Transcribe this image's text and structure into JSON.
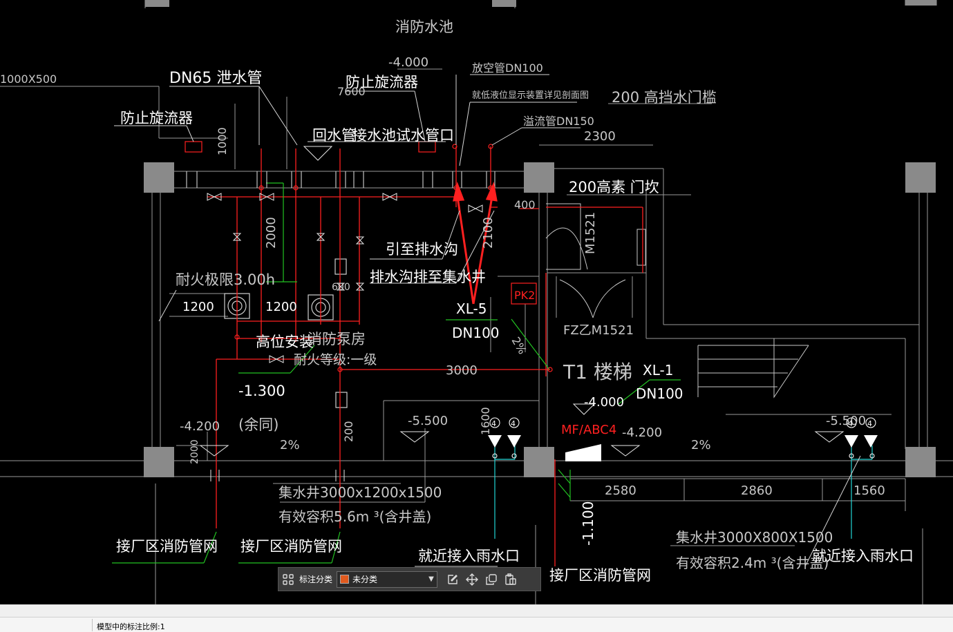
{
  "drawing": {
    "labels": {
      "pool": "消防水池",
      "elev_top": "-4.000",
      "vent": "放空管DN100",
      "gauge": "就低液位显示装置详见剖面图",
      "dn65": "DN65 泄水管",
      "vortex1": "防止旋流器",
      "vortex2": "防止旋流器",
      "dim_7600": "7600",
      "size_left": "1000X500",
      "door_sill": "200  高挡水门槛",
      "overflow": "溢流管DN150",
      "return": "回水管",
      "test": "接水池试水管口",
      "dim_1000": "1000",
      "dim_2300": "2300",
      "door_200": "200高素 门坎",
      "dim_400": "400",
      "m1521": "M1521",
      "to_drain": "引至排水沟",
      "drain_pit": "排水沟排至集水井",
      "dim_2000": "2000",
      "dim_2100": "2100",
      "fire_limit": "耐火极限3.00h",
      "dim_1200a": "1200",
      "dim_1200b": "1200",
      "dim_600": "600",
      "xl5": "XL-5",
      "dn100a": "DN100",
      "pk2": "PK2",
      "fz": "FZ乙M1521",
      "high": "高位安装",
      "pump_room": "消防泵房",
      "fire_grade": "耐火等级:一级",
      "dim_3000": "3000",
      "stairs": "T1 楼梯",
      "xl1": "XL-1",
      "dn100b": "DN100",
      "elev_1300": "-1.300",
      "elev_4000": "-4.000",
      "elev_4200a": "-4.200",
      "same": "(余同)",
      "slope1": "2%",
      "slope2": "2%",
      "slope3": "2%",
      "elev_5500a": "-5.500",
      "elev_5500b": "-5.500",
      "dim_1600": "1600",
      "dim_200": "200",
      "dim_2000b": "2000",
      "mfabc": "MF/ABC4",
      "elev_4200b": "-4.200",
      "dim_2580": "2580",
      "dim_2860": "2860",
      "dim_1560": "1560",
      "elev_1100": "-1.100",
      "pit1": "集水井3000x1200x1500",
      "vol1": "有效容积5.6m  ³(含井盖)",
      "pit2": "集水井3000X800X1500",
      "vol2": "有效容积2.4m  ³(含井盖)",
      "net1": "接厂区消防管网",
      "net2": "接厂区消防管网",
      "net3": "接厂区消防管网",
      "rain1": "就近接入雨水口",
      "rain2": "就近接入雨水口",
      "tag4a": "4",
      "tag4b": "4",
      "tag4c": "4",
      "tag4d": "4",
      "slope_v": "2%"
    }
  },
  "toolbar": {
    "grid_icon": "grid-icon",
    "label": "标注分类",
    "category": "未分类",
    "category_color": "#e05a1e",
    "icons": [
      "edit-icon",
      "move-icon",
      "copy-icon",
      "paste-icon"
    ]
  },
  "status": {
    "scale_text": "模型中的标注比例:1"
  }
}
